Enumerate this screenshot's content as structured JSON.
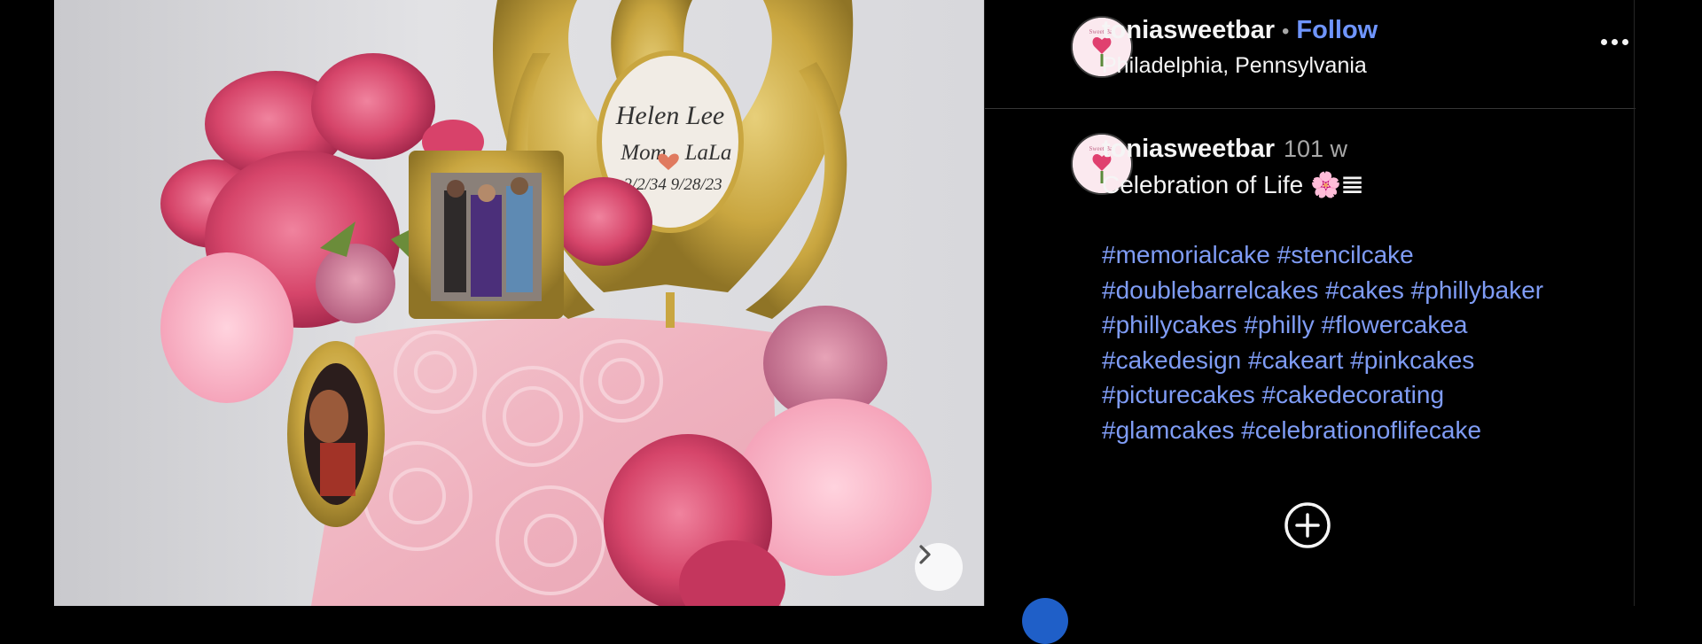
{
  "post": {
    "username": "toniasweetbar",
    "follow_label": "Follow",
    "separator": "•",
    "location": "Philadelphia, Pennsylvania",
    "more_icon": "more-horizontal-icon"
  },
  "media": {
    "topper_name": "Helen Lee",
    "topper_line2_left": "Mom",
    "topper_line2_right": "LaLa",
    "topper_dates": "2/2/34  9/28/23",
    "next_icon": "chevron-right-icon"
  },
  "caption": {
    "username": "toniasweetbar",
    "age": "101 w",
    "text": "Celebration of Life 🌸𝌆",
    "hashtags": [
      "#memorialcake",
      "#stencilcake",
      "#doublebarrelcakes",
      "#cakes",
      "#phillybaker",
      "#phillycakes",
      "#philly",
      "#flowercakea",
      "#cakedesign",
      "#cakeart",
      "#pinkcakes",
      "#picturecakes",
      "#cakedecorating",
      "#glamcakes",
      "#celebrationoflifecake"
    ],
    "load_more_icon": "plus-circle-icon"
  },
  "colors": {
    "background": "#000000",
    "link": "#7f9cf5",
    "follow": "#6f95ff",
    "muted": "#a8a8a8"
  }
}
